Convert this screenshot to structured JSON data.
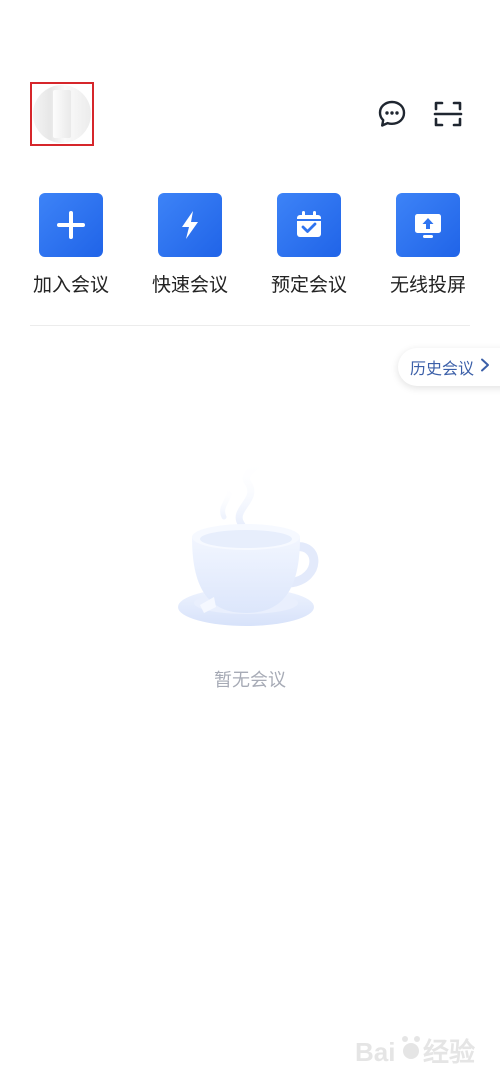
{
  "header": {
    "avatar_icon": "avatar-icon",
    "message_icon": "chat-bubble-icon",
    "scan_icon": "scan-icon"
  },
  "actions": [
    {
      "label": "加入会议",
      "icon": "plus-icon"
    },
    {
      "label": "快速会议",
      "icon": "lightning-icon"
    },
    {
      "label": "预定会议",
      "icon": "calendar-check-icon"
    },
    {
      "label": "无线投屏",
      "icon": "screen-cast-icon"
    }
  ],
  "history": {
    "label": "历史会议",
    "icon": "chevron-right-icon"
  },
  "empty_state": {
    "text": "暂无会议",
    "icon": "coffee-cup-icon"
  },
  "colors": {
    "accent": "#2f74f0",
    "history_text": "#3b5fa8",
    "empty_text": "#a7abb6",
    "avatar_highlight": "#d6262b"
  },
  "watermark": {
    "text": "Baidu 经验"
  }
}
